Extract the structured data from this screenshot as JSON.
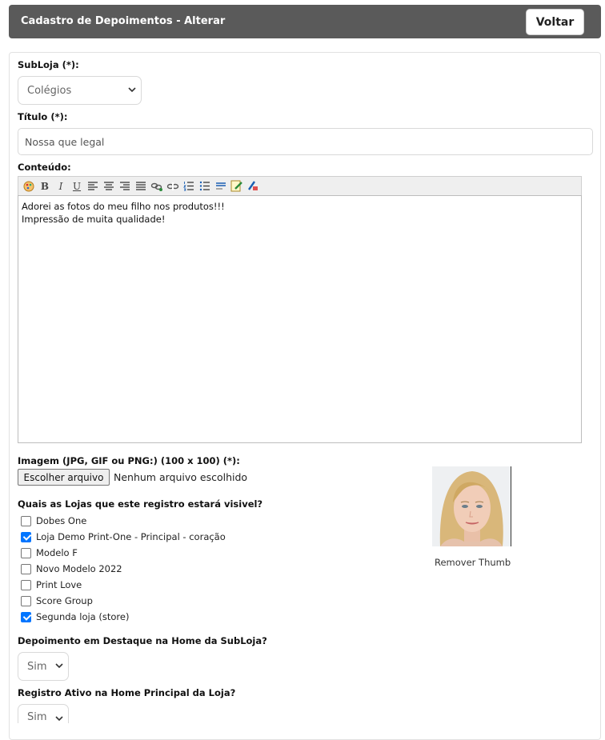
{
  "header": {
    "title": "Cadastro de Depoimentos - Alterar",
    "back_label": "Voltar"
  },
  "form": {
    "subloja": {
      "label": "SubLoja (*):",
      "selected": "Colégios"
    },
    "titulo": {
      "label": "Título (*):",
      "value": "Nossa que legal"
    },
    "conteudo": {
      "label": "Conteúdo:",
      "toolbar_icons": [
        "spellcheck-icon",
        "bold-icon",
        "italic-icon",
        "underline-icon",
        "align-left-icon",
        "align-center-icon",
        "align-right-icon",
        "justify-icon",
        "link-icon",
        "unlink-icon",
        "ordered-list-icon",
        "unordered-list-icon",
        "horizontal-rule-icon",
        "edit-html-icon",
        "remove-format-icon"
      ],
      "toolbar_glyphs": {
        "bold": "B",
        "italic": "I",
        "underline": "U"
      },
      "lines": [
        "Adorei as fotos do meu filho nos produtos!!!",
        "Impressão de muita qualidade!"
      ]
    },
    "imagem": {
      "label": "Imagem (JPG, GIF ou PNG:) (100 x 100) (*):",
      "button_label": "Escolher arquivo",
      "status": "Nenhum arquivo escolhido",
      "remove_label": "Remover Thumb"
    },
    "lojas": {
      "label": "Quais as Lojas que este registro estará visivel?",
      "items": [
        {
          "label": "Dobes One",
          "checked": false
        },
        {
          "label": "Loja Demo Print-One - Principal - coração",
          "checked": true
        },
        {
          "label": "Modelo F",
          "checked": false
        },
        {
          "label": "Novo Modelo 2022",
          "checked": false
        },
        {
          "label": "Print Love",
          "checked": false
        },
        {
          "label": "Score Group",
          "checked": false
        },
        {
          "label": "Segunda loja (store)",
          "checked": true
        }
      ]
    },
    "destaque": {
      "label": "Depoimento em Destaque na Home da SubLoja?",
      "selected": "Sim"
    },
    "ativo": {
      "label": "Registro Ativo na Home Principal da Loja?",
      "selected": "Sim"
    }
  },
  "colors": {
    "header_bg": "#5a5a5a",
    "checkbox_checked": "#0075ff"
  }
}
